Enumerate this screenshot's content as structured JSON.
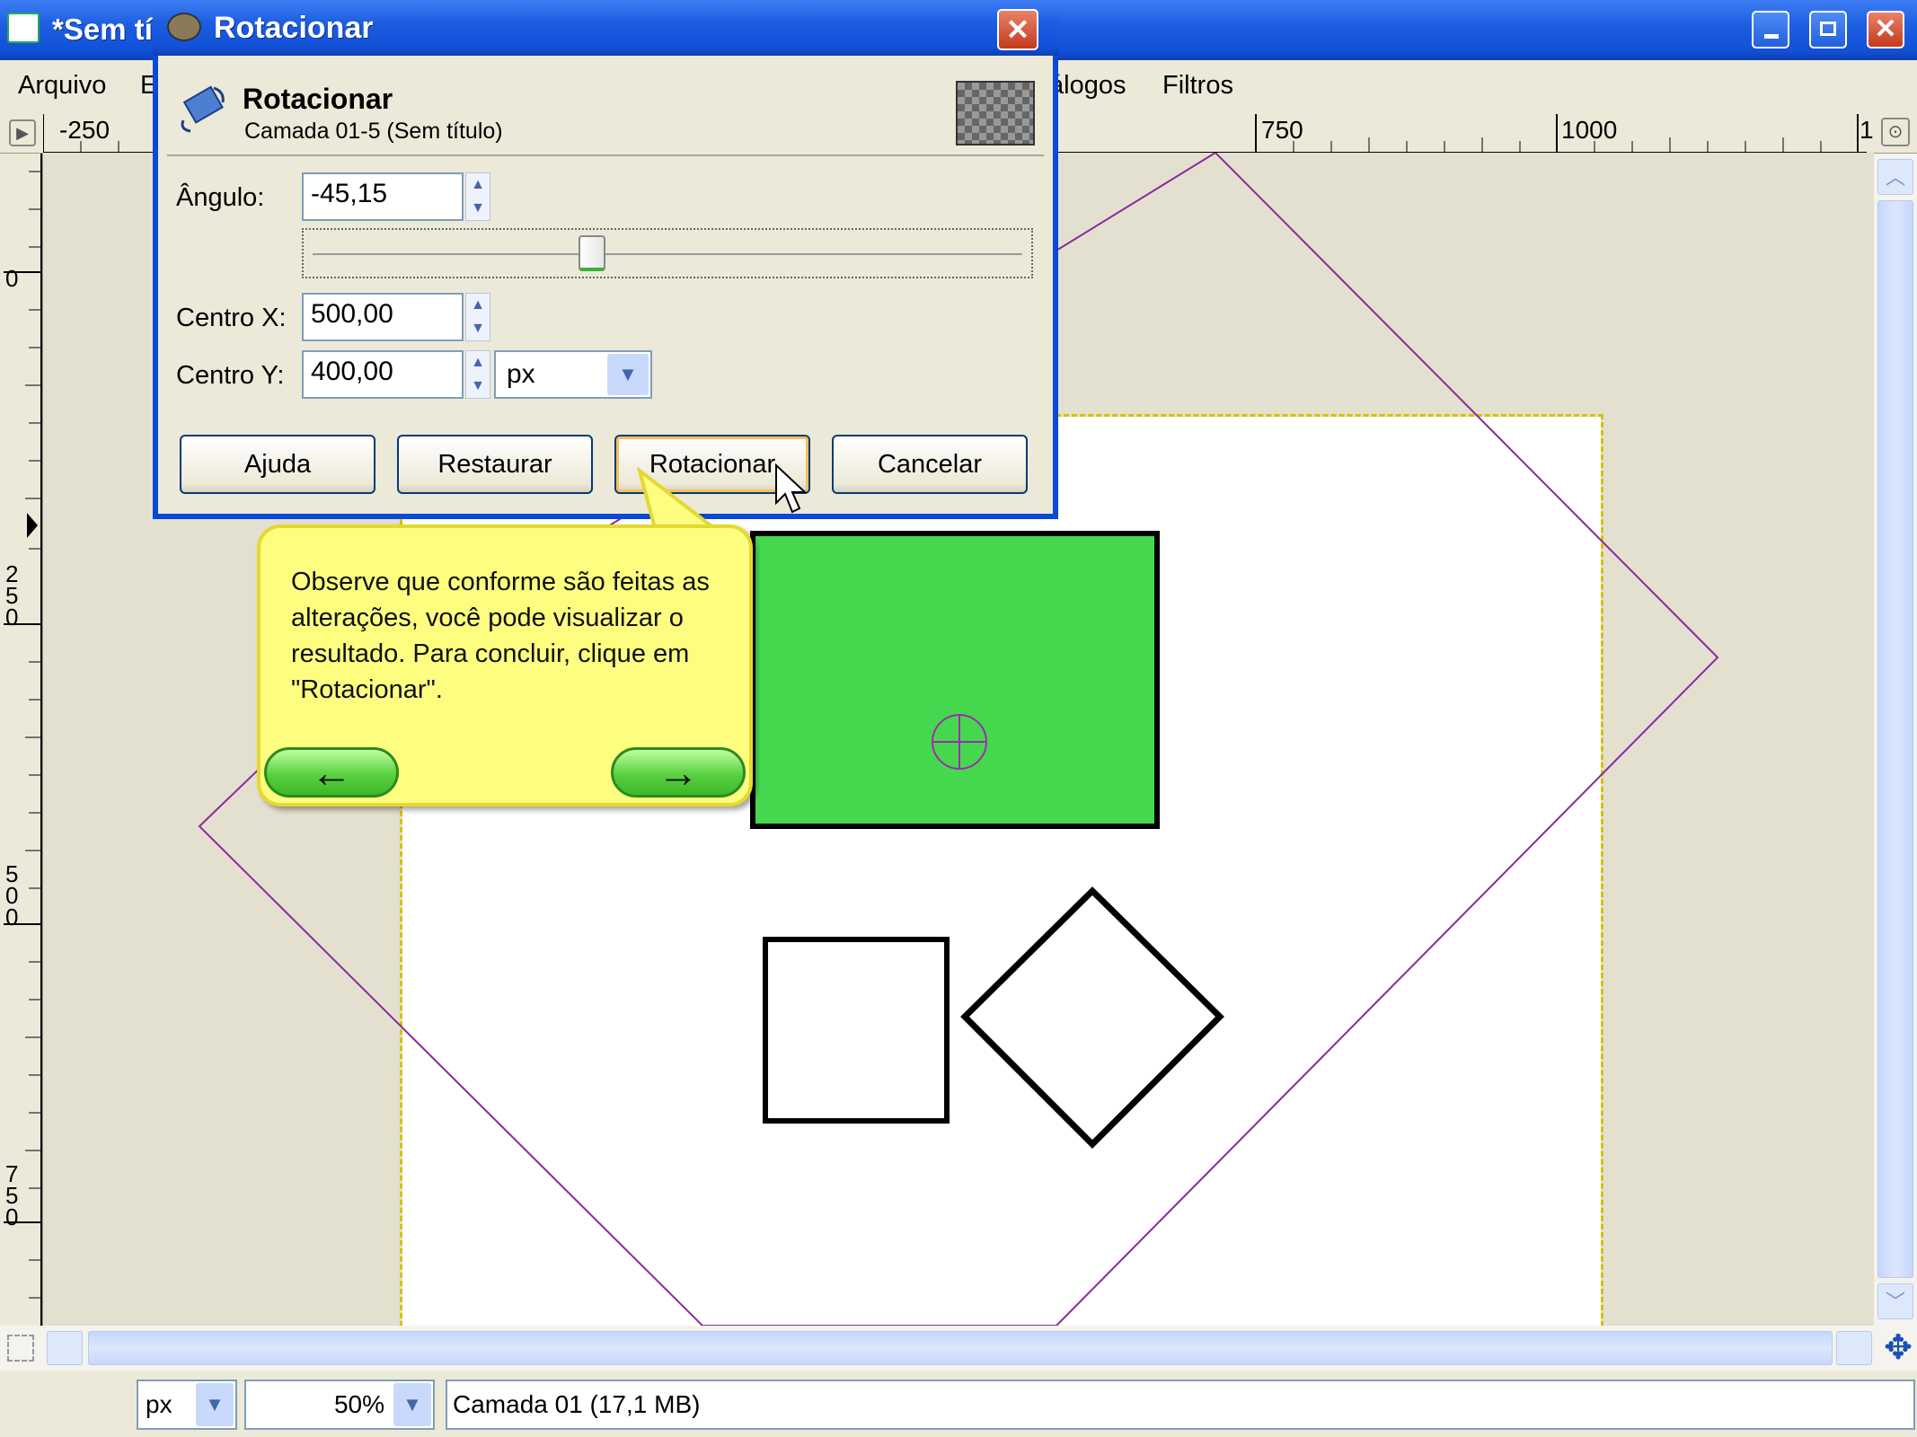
{
  "window": {
    "title": "*Sem tí"
  },
  "menu": {
    "arquivo": "Arquivo",
    "editar": "E",
    "dialogos": "álogos",
    "filtros": "Filtros"
  },
  "ruler_top": {
    "m250": "-250",
    "m750": "750",
    "m1000": "1000",
    "m1": "1"
  },
  "ruler_left": {
    "m0": "0",
    "m250": "2\n5\n0",
    "m500": "5\n0\n0",
    "m750": "7\n5\n0"
  },
  "dialog": {
    "title": "Rotacionar",
    "header_title": "Rotacionar",
    "header_subtitle": "Camada 01-5 (Sem título)",
    "angle_label": "Ângulo:",
    "angle_value": "-45,15",
    "angle_slider_fraction": 0.5,
    "center_x_label": "Centro X:",
    "center_x_value": "500,00",
    "center_y_label": "Centro Y:",
    "center_y_value": "400,00",
    "unit_value": "px",
    "buttons": {
      "help": "Ajuda",
      "reset": "Restaurar",
      "rotate": "Rotacionar",
      "cancel": "Cancelar"
    }
  },
  "tooltip": {
    "text": "Observe que conforme são feitas as alterações, você pode visualizar o resultado. Para concluir, clique em \"Rotacionar\".",
    "back": "←",
    "next": "→"
  },
  "status": {
    "unit": "px",
    "zoom": "50%",
    "layer_info": "Camada 01 (17,1 MB)"
  },
  "colors": {
    "accent_green": "#45d84e",
    "guide_purple": "#8a2a9a",
    "selection_yellow": "#d8c000"
  }
}
